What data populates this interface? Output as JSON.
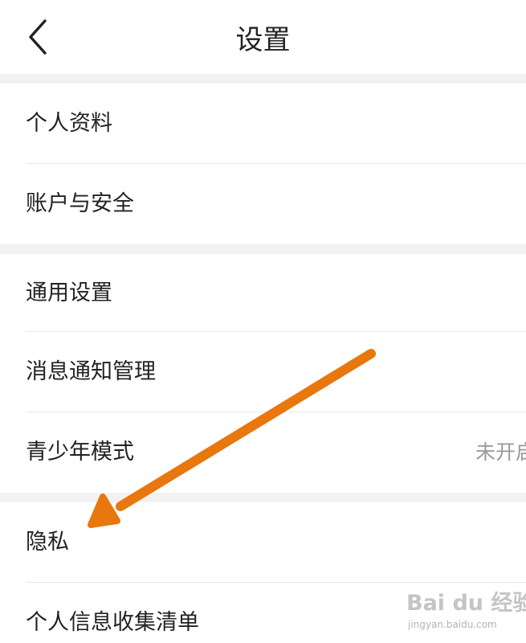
{
  "header": {
    "title": "设置",
    "back_icon": "chevron-left-icon"
  },
  "groups": [
    {
      "items": [
        {
          "label": "个人资料"
        },
        {
          "label": "账户与安全"
        }
      ]
    },
    {
      "items": [
        {
          "label": "通用设置"
        },
        {
          "label": "消息通知管理"
        },
        {
          "label": "青少年模式",
          "value": "未开启"
        }
      ]
    },
    {
      "items": [
        {
          "label": "隐私"
        },
        {
          "label": "个人信息收集清单"
        }
      ]
    }
  ],
  "annotation": {
    "icon": "arrow-icon",
    "color": "#E8770E"
  },
  "watermark": {
    "main": "Bai du 经验",
    "sub": "jingyan.baidu.com"
  },
  "colors": {
    "background": "#FFFFFF",
    "section_divider": "#F2F2F2",
    "text": "#222222",
    "secondary_text": "#9A9A9A"
  }
}
